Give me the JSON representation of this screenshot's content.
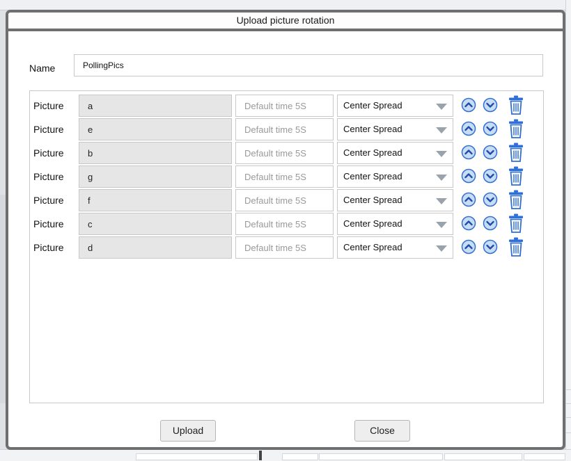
{
  "dialog": {
    "title": "Upload picture rotation",
    "name_label": "Name",
    "name_value": "PollingPics"
  },
  "rows": [
    {
      "label": "Picture",
      "picture": "a",
      "time_placeholder": "Default time 5S",
      "mode": "Center Spread"
    },
    {
      "label": "Picture",
      "picture": "e",
      "time_placeholder": "Default time 5S",
      "mode": "Center Spread"
    },
    {
      "label": "Picture",
      "picture": "b",
      "time_placeholder": "Default time 5S",
      "mode": "Center Spread"
    },
    {
      "label": "Picture",
      "picture": "g",
      "time_placeholder": "Default time 5S",
      "mode": "Center Spread"
    },
    {
      "label": "Picture",
      "picture": "f",
      "time_placeholder": "Default time 5S",
      "mode": "Center Spread"
    },
    {
      "label": "Picture",
      "picture": "c",
      "time_placeholder": "Default time 5S",
      "mode": "Center Spread"
    },
    {
      "label": "Picture",
      "picture": "d",
      "time_placeholder": "Default time 5S",
      "mode": "Center Spread"
    }
  ],
  "icons": {
    "move_up": "chevron-up-circle-icon",
    "move_down": "chevron-down-circle-icon",
    "delete": "trash-icon",
    "dropdown": "dropdown-triangle-icon"
  },
  "colors": {
    "accent": "#2f6fd6",
    "accent_light": "#c9dcf6",
    "border": "#6f6f6f"
  },
  "buttons": {
    "upload": "Upload",
    "close": "Close"
  }
}
